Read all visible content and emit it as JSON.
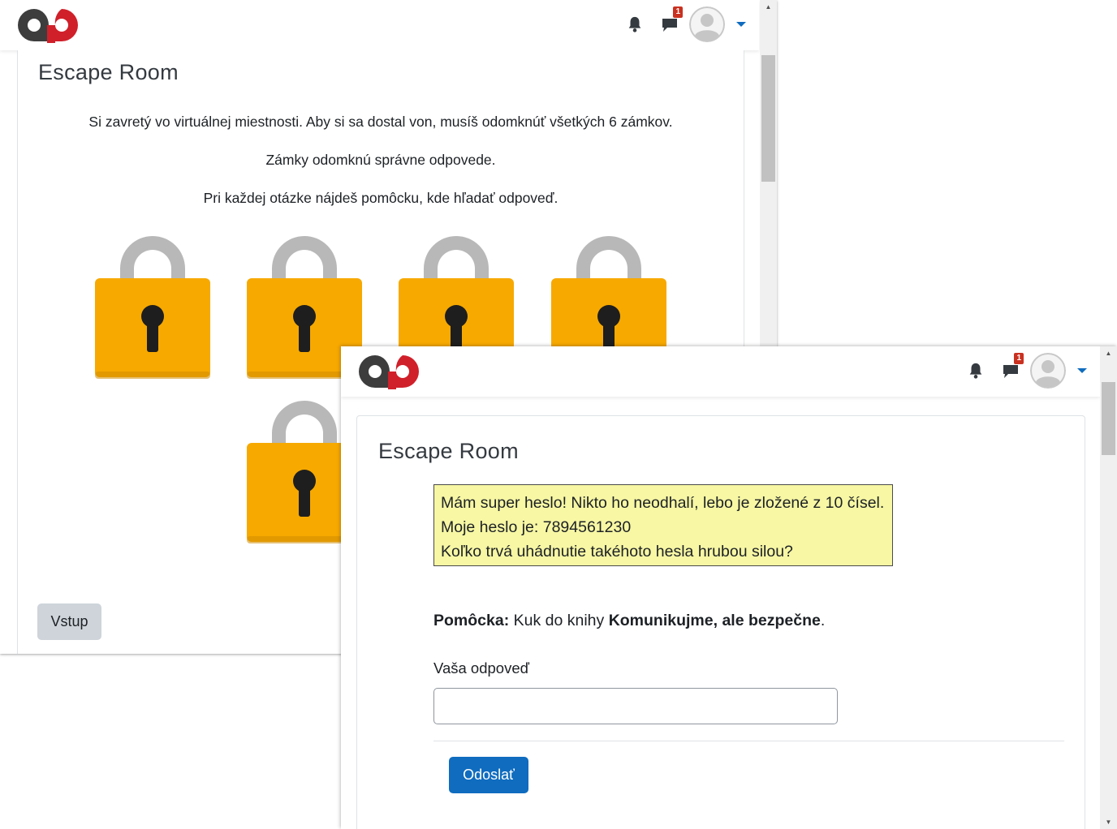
{
  "back_window": {
    "notifications_badge": "1",
    "title": "Escape Room",
    "intro": [
      "Si zavretý vo virtuálnej miestnosti. Aby si sa dostal von, musíš odomknúť všetkých 6 zámkov.",
      "Zámky odomknú správne odpovede.",
      "Pri každej otázke nájdeš pomôcku, kde hľadať odpoveď."
    ],
    "enter_button": "Vstup"
  },
  "front_window": {
    "notifications_badge": "1",
    "title": "Escape Room",
    "question_lines": [
      "Mám super heslo! Nikto ho neodhalí, lebo je zložené z 10 čísel.",
      "Moje heslo je: 7894561230",
      "Koľko trvá uhádnutie takéhoto hesla hrubou silou?"
    ],
    "hint": {
      "label": "Pomôcka:",
      "text_before": " Kuk do knihy ",
      "book": "Komunikujme, ale bezpečne",
      "text_after": "."
    },
    "answer_label": "Vaša odpoveď",
    "answer_value": "",
    "submit_button": "Odoslať"
  },
  "colors": {
    "lock_body": "#f7a900",
    "lock_shackle": "#b8b8b8",
    "primary": "#0f6cbf",
    "logo_dark": "#3d3d3d",
    "logo_red": "#d0202a",
    "question_bg": "#f7f7a4"
  },
  "icons": [
    "logo-icon",
    "bell-icon",
    "chat-icon",
    "user-avatar-icon",
    "chevron-down-icon",
    "padlock-icon"
  ]
}
